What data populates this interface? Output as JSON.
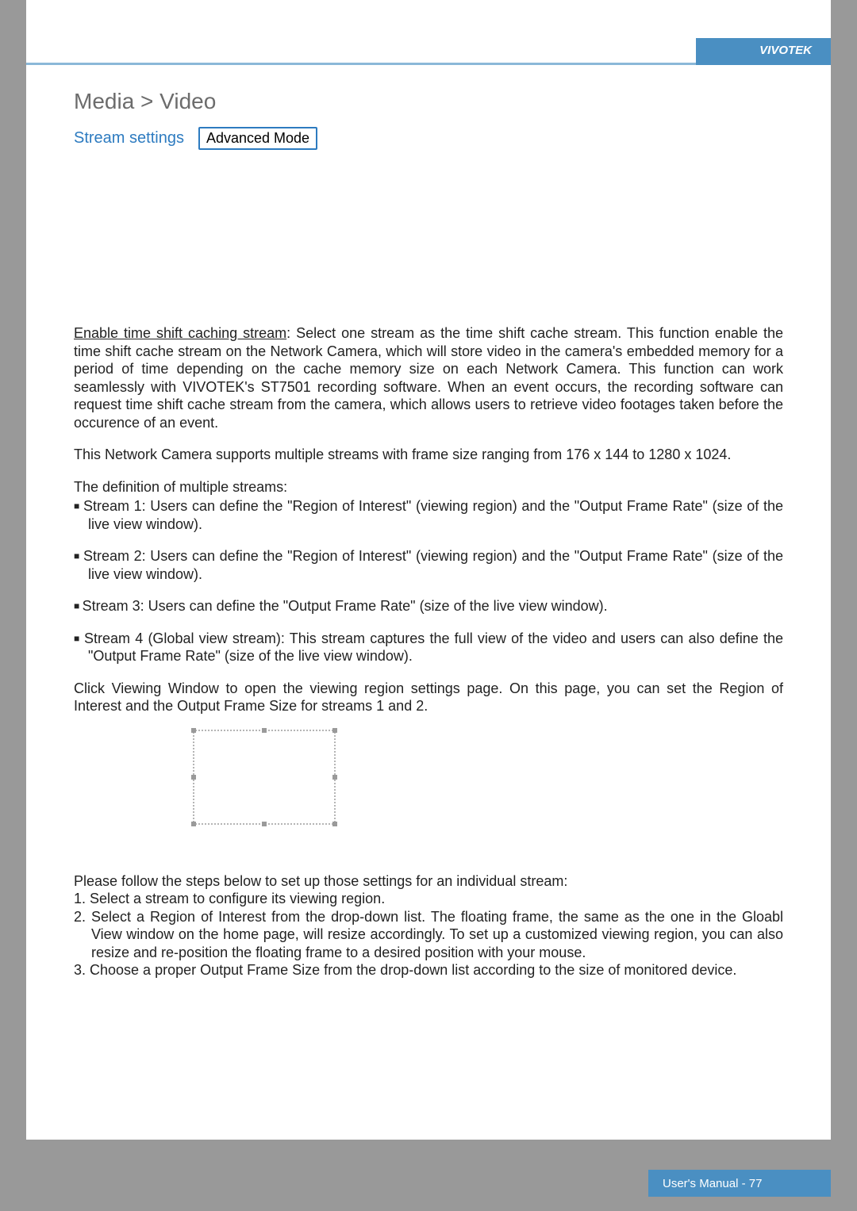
{
  "brand": "VIVOTEK",
  "title": "Media > Video",
  "subtitle": "Stream settings",
  "mode_pill": "Advanced Mode",
  "para_timeshift_label": "Enable time shift caching stream",
  "para_timeshift_body": ": Select one stream as the time shift cache stream. This function enable the time shift cache stream on the Network Camera, which will store video in the camera's embedded memory for a period of time depending on the cache memory size on each Network Camera. This function can work seamlessly with VIVOTEK's ST7501 recording software. When an event occurs, the recording software can request time shift cache stream from the camera, which allows users to retrieve video footages taken before the occurence of an event.",
  "para_multistream": "This Network Camera supports multiple streams with frame size ranging from 176 x 144 to 1280 x 1024.",
  "para_definition_header": "The definition of multiple streams:",
  "bullets": {
    "s1": "Stream 1: Users can define the \"Region of Interest\" (viewing region) and the \"Output Frame Rate\" (size of the live view window).",
    "s2": "Stream 2: Users can define the \"Region of Interest\" (viewing region) and the \"Output Frame Rate\" (size of the live view window).",
    "s3": "Stream 3: Users can define the \"Output Frame Rate\" (size of the live view window).",
    "s4": "Stream 4 (Global view stream): This stream captures the full view of the video and users can also define the \"Output Frame Rate\" (size of the live view window)."
  },
  "para_viewingwindow": "Click Viewing Window to open the viewing region settings page. On this page, you can set the Region of Interest and the Output Frame Size for streams 1 and 2.",
  "steps_header": "Please follow the steps below to set up those settings for an individual stream:",
  "steps": {
    "one": "1. Select a stream to configure its viewing region.",
    "two": "2. Select a Region of Interest from the drop-down list. The floating frame, the same as the one in the Gloabl View window on the home page, will resize accordingly. To set up a customized viewing region, you can also resize and re-position the floating frame to a desired position with your mouse.",
    "three": "3. Choose a proper Output Frame Size from the drop-down list according to the size of monitored device."
  },
  "footer": "User's Manual - 77"
}
